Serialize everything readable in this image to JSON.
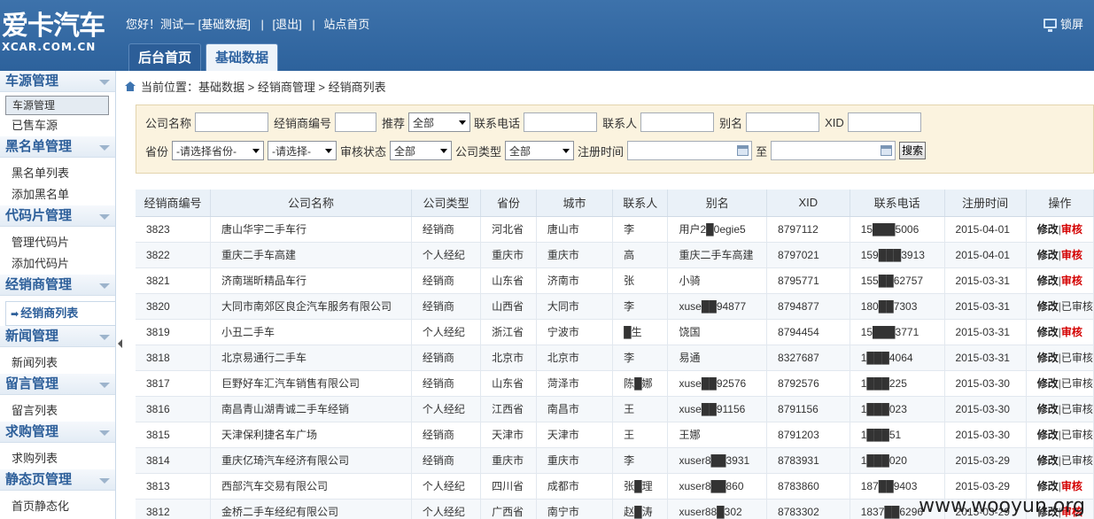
{
  "logo": {
    "cn": "爱卡汽车",
    "en": "XCAR.COM.CN"
  },
  "topbar": {
    "greeting": "您好！测试一 [基础数据]",
    "logout": "[退出]",
    "site_home": "站点首页",
    "lock": "锁屏"
  },
  "tabs": [
    {
      "label": "后台首页"
    },
    {
      "label": "基础数据"
    }
  ],
  "sidebar": {
    "groups": [
      {
        "title": "车源管理",
        "items": [
          "车源管理",
          "已售车源"
        ]
      },
      {
        "title": "黑名单管理",
        "items": [
          "黑名单列表",
          "添加黑名单"
        ]
      },
      {
        "title": "代码片管理",
        "items": [
          "管理代码片",
          "添加代码片"
        ]
      },
      {
        "title": "经销商管理",
        "items": [
          "经销商列表"
        ]
      },
      {
        "title": "新闻管理",
        "items": [
          "新闻列表"
        ]
      },
      {
        "title": "留言管理",
        "items": [
          "留言列表"
        ]
      },
      {
        "title": "求购管理",
        "items": [
          "求购列表"
        ]
      },
      {
        "title": "静态页管理",
        "items": [
          "首页静态化"
        ]
      }
    ]
  },
  "breadcrumb": "当前位置：基础数据 > 经销商管理 > 经销商列表",
  "search": {
    "company_label": "公司名称",
    "dealer_no_label": "经销商编号",
    "recommend_label": "推荐",
    "recommend_value": "全部",
    "phone_label": "联系电话",
    "contact_label": "联系人",
    "alias_label": "别名",
    "xid_label": "XID",
    "province_label": "省份",
    "province_value": "-请选择省份-",
    "city_value": "-请选择-",
    "audit_label": "审核状态",
    "audit_value": "全部",
    "type_label": "公司类型",
    "type_value": "全部",
    "regtime_label": "注册时间",
    "to_label": "至",
    "search_button": "搜索"
  },
  "table": {
    "columns": [
      "经销商编号",
      "公司名称",
      "公司类型",
      "省份",
      "城市",
      "联系人",
      "别名",
      "XID",
      "联系电话",
      "注册时间",
      "操作"
    ],
    "rows": [
      {
        "no": "3823",
        "name": "唐山华宇二手车行",
        "type": "经销商",
        "prov": "河北省",
        "city": "唐山市",
        "contact": "李",
        "alias": "用户2█0egie5",
        "xid": "8797112",
        "phone": "15███5006",
        "date": "2015-04-01",
        "op": "修改",
        "status": "审核",
        "audited": false
      },
      {
        "no": "3822",
        "name": "重庆二手车高建",
        "type": "个人经纪",
        "prov": "重庆市",
        "city": "重庆市",
        "contact": "高",
        "alias": "重庆二手车高建",
        "xid": "8797021",
        "phone": "159███3913",
        "date": "2015-04-01",
        "op": "修改",
        "status": "审核",
        "audited": false
      },
      {
        "no": "3821",
        "name": "济南瑞昕精品车行",
        "type": "经销商",
        "prov": "山东省",
        "city": "济南市",
        "contact": "张",
        "alias": "小骑",
        "xid": "8795771",
        "phone": "155██62757",
        "date": "2015-03-31",
        "op": "修改",
        "status": "审核",
        "audited": false
      },
      {
        "no": "3820",
        "name": "大同市南郊区良企汽车服务有限公司",
        "type": "经销商",
        "prov": "山西省",
        "city": "大同市",
        "contact": "李",
        "alias": "xuse██94877",
        "xid": "8794877",
        "phone": "180██7303",
        "date": "2015-03-31",
        "op": "修改",
        "status": "已审核",
        "audited": true
      },
      {
        "no": "3819",
        "name": "小丑二手车",
        "type": "个人经纪",
        "prov": "浙江省",
        "city": "宁波市",
        "contact": "█生",
        "alias": "饶国",
        "xid": "8794454",
        "phone": "15███3771",
        "date": "2015-03-31",
        "op": "修改",
        "status": "审核",
        "audited": false
      },
      {
        "no": "3818",
        "name": "北京易通行二手车",
        "type": "经销商",
        "prov": "北京市",
        "city": "北京市",
        "contact": "李",
        "alias": "易通",
        "xid": "8327687",
        "phone": "1███4064",
        "date": "2015-03-31",
        "op": "修改",
        "status": "已审核",
        "audited": true
      },
      {
        "no": "3817",
        "name": "巨野好车汇汽车销售有限公司",
        "type": "经销商",
        "prov": "山东省",
        "city": "菏泽市",
        "contact": "陈█娜",
        "alias": "xuse██92576",
        "xid": "8792576",
        "phone": "1███225",
        "date": "2015-03-30",
        "op": "修改",
        "status": "已审核",
        "audited": true
      },
      {
        "no": "3816",
        "name": "南昌青山湖青诚二手车经销",
        "type": "个人经纪",
        "prov": "江西省",
        "city": "南昌市",
        "contact": "王",
        "alias": "xuse██91156",
        "xid": "8791156",
        "phone": "1███023",
        "date": "2015-03-30",
        "op": "修改",
        "status": "已审核",
        "audited": true
      },
      {
        "no": "3815",
        "name": "天津保利捷名车广场",
        "type": "经销商",
        "prov": "天津市",
        "city": "天津市",
        "contact": "王",
        "alias": "王娜",
        "xid": "8791203",
        "phone": "1███51",
        "date": "2015-03-30",
        "op": "修改",
        "status": "已审核",
        "audited": true
      },
      {
        "no": "3814",
        "name": "重庆亿琦汽车经济有限公司",
        "type": "经销商",
        "prov": "重庆市",
        "city": "重庆市",
        "contact": "李",
        "alias": "xuser8██3931",
        "xid": "8783931",
        "phone": "1███020",
        "date": "2015-03-29",
        "op": "修改",
        "status": "已审核",
        "audited": true
      },
      {
        "no": "3813",
        "name": "西部汽车交易有限公司",
        "type": "个人经纪",
        "prov": "四川省",
        "city": "成都市",
        "contact": "张█理",
        "alias": "xuser8██860",
        "xid": "8783860",
        "phone": "187██9403",
        "date": "2015-03-29",
        "op": "修改",
        "status": "审核",
        "audited": false
      },
      {
        "no": "3812",
        "name": "金桥二手车经纪有限公司",
        "type": "个人经纪",
        "prov": "广西省",
        "city": "南宁市",
        "contact": "赵█涛",
        "alias": "xuser88█302",
        "xid": "8783302",
        "phone": "1837██6296",
        "date": "2015-03-29",
        "op": "修改",
        "status": "审核",
        "audited": false
      }
    ]
  },
  "watermark": "www.wooyun.org",
  "colors": {
    "header": "#2d629c",
    "audit_red": "#d40000",
    "search_bg": "#fbf3df"
  }
}
